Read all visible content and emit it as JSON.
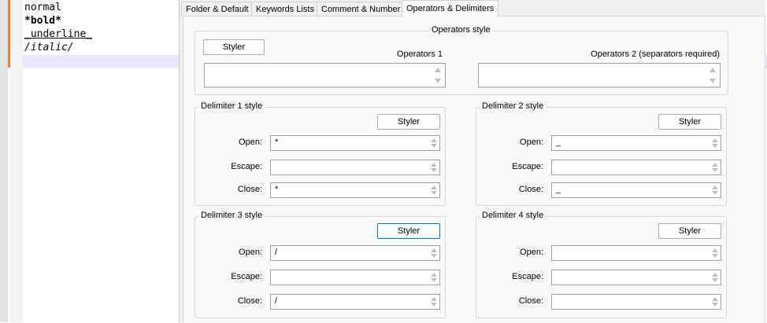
{
  "editor": {
    "lines": [
      "normal",
      "*bold*",
      "_underline_",
      "/italic/"
    ]
  },
  "tabs": [
    "Folder & Default",
    "Keywords Lists",
    "Comment & Number",
    "Operators & Delimiters"
  ],
  "operators": {
    "legend": "Operators style",
    "styler": "Styler",
    "op1_label": "Operators 1",
    "op2_label": "Operators 2 (separators required)",
    "op1_value": "",
    "op2_value": ""
  },
  "delimiters": [
    {
      "legend": "Delimiter 1 style",
      "styler": "Styler",
      "open_label": "Open:",
      "escape_label": "Escape:",
      "close_label": "Close:",
      "open": "*",
      "escape": "",
      "close": "*"
    },
    {
      "legend": "Delimiter 2 style",
      "styler": "Styler",
      "open_label": "Open:",
      "escape_label": "Escape:",
      "close_label": "Close:",
      "open": "_",
      "escape": "",
      "close": "_"
    },
    {
      "legend": "Delimiter 3 style",
      "styler": "Styler",
      "open_label": "Open:",
      "escape_label": "Escape:",
      "close_label": "Close:",
      "open": "/",
      "escape": "",
      "close": "/"
    },
    {
      "legend": "Delimiter 4 style",
      "styler": "Styler",
      "open_label": "Open:",
      "escape_label": "Escape:",
      "close_label": "Close:",
      "open": "",
      "escape": "",
      "close": ""
    }
  ],
  "colors": {
    "change_bar": "#f08030",
    "current_line": "#e8e8ff",
    "focus_border": "#0078d7"
  }
}
